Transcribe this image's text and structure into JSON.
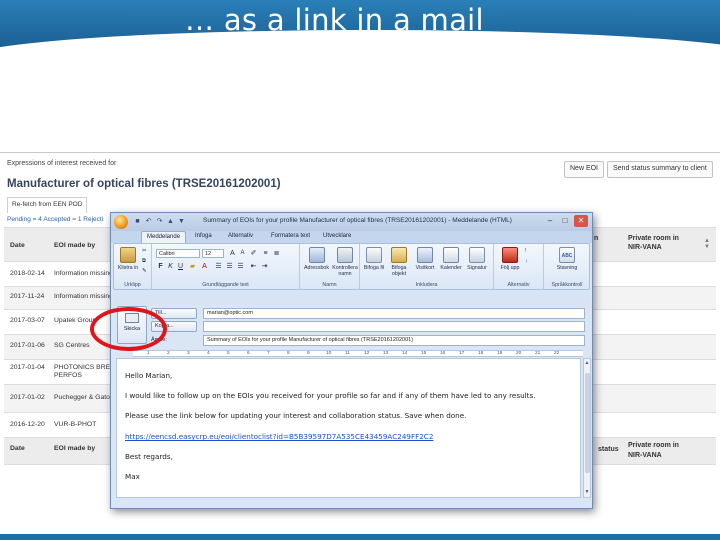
{
  "slide": {
    "title": "… as a link in a mail"
  },
  "app": {
    "subtitle": "Expressions of interest received for",
    "title": "Manufacturer of optical fibres (TRSE20161202001)",
    "buttons": {
      "new_eoi": "New EOI",
      "send_status": "Send status summary to client"
    },
    "tab_refetch": "Re-fetch from EEN POD",
    "pending_text": "Pending = 4 Accepted = 1 Rejecti",
    "table": {
      "header": {
        "date": "Date",
        "by": "EOI made by",
        "status": "n",
        "room_line1": "Private room in",
        "room_line2": "NIR-VANA"
      },
      "rows": [
        {
          "date": "2018-02-14",
          "by": "Information missing"
        },
        {
          "date": "2017-11-24",
          "by": "Information missing"
        },
        {
          "date": "2017-03-07",
          "by": "Upatek Group"
        },
        {
          "date": "2017-01-06",
          "by": "SG Centres"
        },
        {
          "date": "2017-01-04",
          "by": "PHOTONICS BRE",
          "by2": "PERFOS"
        },
        {
          "date": "2017-01-02",
          "by": "Puchegger & Gato"
        },
        {
          "date": "2016-12-20",
          "by": "VUR-B-PHOT"
        }
      ],
      "footer": {
        "date": "Date",
        "by": "EOI made by",
        "status": "status",
        "room_line1": "Private room in",
        "room_line2": "NIR-VANA"
      }
    }
  },
  "mail": {
    "window_title": "Summary of EOIs for your profile Manufacturer of optical fibres (TRSE20161202001) - Meddelande (HTML)",
    "ribbon_tabs": [
      "Meddelande",
      "Infoga",
      "Alternativ",
      "Formatera text",
      "Utvecklare"
    ],
    "ribbon": {
      "clipboard": {
        "paste": "Klistra in",
        "label": "Urklipp"
      },
      "font": {
        "name": "Calibri",
        "size": "12",
        "label": "Grundläggande text"
      },
      "names": {
        "address_book": "Adressbok",
        "check_names": "Kontrollera namn",
        "label": "Namn"
      },
      "include": {
        "attach_file": "Bifoga fil",
        "attach_item": "Bifoga objekt",
        "business_card": "Visitkort",
        "calendar": "Kalender",
        "signature": "Signatur",
        "label": "Inkludera"
      },
      "options": {
        "follow_up": "Följ upp",
        "label": "Alternativ"
      },
      "proofing": {
        "spelling": "Stavning",
        "label": "Språkkontroll"
      }
    },
    "send_label": "Skicka",
    "to_label": "Till...",
    "cc_label": "Kopia...",
    "subject_label": "Ämne:",
    "to_value": "marian@optic.com",
    "cc_value": "",
    "subject_value": "Summary of EOIs for your profile Manufacturer of optical fibres (TRSE20161202001)",
    "ruler_numbers": [
      "1",
      "2",
      "3",
      "4",
      "5",
      "6",
      "7",
      "8",
      "9",
      "10",
      "11",
      "12",
      "13",
      "14",
      "15",
      "16",
      "17",
      "18",
      "19",
      "20",
      "21",
      "22"
    ],
    "body": {
      "greeting": "Hello Marian,",
      "line1": "I would like to follow up on the EOIs you received for your profile so far and if any of them have led to any results.",
      "line2": "Please use the link below for updating your interest and collaboration status. Save when done.",
      "link": "https://eencsd.easycrp.eu/eoi/clientoclist?id=B5B39597D7A535CE43459AC249FF2C2",
      "closing": "Best regards,",
      "signature": "Max"
    }
  },
  "colors": {
    "header_blue": "#1d6fa8",
    "annotation_red": "#e0141b",
    "link_blue": "#1a4fd3"
  }
}
